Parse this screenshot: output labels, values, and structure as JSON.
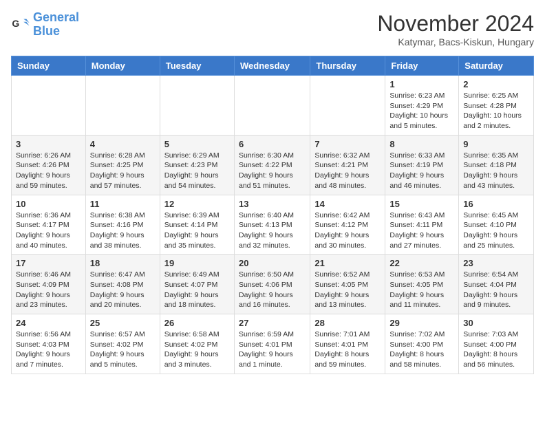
{
  "logo": {
    "line1": "General",
    "line2": "Blue"
  },
  "title": "November 2024",
  "location": "Katymar, Bacs-Kiskun, Hungary",
  "days_of_week": [
    "Sunday",
    "Monday",
    "Tuesday",
    "Wednesday",
    "Thursday",
    "Friday",
    "Saturday"
  ],
  "weeks": [
    [
      {
        "day": "",
        "info": ""
      },
      {
        "day": "",
        "info": ""
      },
      {
        "day": "",
        "info": ""
      },
      {
        "day": "",
        "info": ""
      },
      {
        "day": "",
        "info": ""
      },
      {
        "day": "1",
        "info": "Sunrise: 6:23 AM\nSunset: 4:29 PM\nDaylight: 10 hours and 5 minutes."
      },
      {
        "day": "2",
        "info": "Sunrise: 6:25 AM\nSunset: 4:28 PM\nDaylight: 10 hours and 2 minutes."
      }
    ],
    [
      {
        "day": "3",
        "info": "Sunrise: 6:26 AM\nSunset: 4:26 PM\nDaylight: 9 hours and 59 minutes."
      },
      {
        "day": "4",
        "info": "Sunrise: 6:28 AM\nSunset: 4:25 PM\nDaylight: 9 hours and 57 minutes."
      },
      {
        "day": "5",
        "info": "Sunrise: 6:29 AM\nSunset: 4:23 PM\nDaylight: 9 hours and 54 minutes."
      },
      {
        "day": "6",
        "info": "Sunrise: 6:30 AM\nSunset: 4:22 PM\nDaylight: 9 hours and 51 minutes."
      },
      {
        "day": "7",
        "info": "Sunrise: 6:32 AM\nSunset: 4:21 PM\nDaylight: 9 hours and 48 minutes."
      },
      {
        "day": "8",
        "info": "Sunrise: 6:33 AM\nSunset: 4:19 PM\nDaylight: 9 hours and 46 minutes."
      },
      {
        "day": "9",
        "info": "Sunrise: 6:35 AM\nSunset: 4:18 PM\nDaylight: 9 hours and 43 minutes."
      }
    ],
    [
      {
        "day": "10",
        "info": "Sunrise: 6:36 AM\nSunset: 4:17 PM\nDaylight: 9 hours and 40 minutes."
      },
      {
        "day": "11",
        "info": "Sunrise: 6:38 AM\nSunset: 4:16 PM\nDaylight: 9 hours and 38 minutes."
      },
      {
        "day": "12",
        "info": "Sunrise: 6:39 AM\nSunset: 4:14 PM\nDaylight: 9 hours and 35 minutes."
      },
      {
        "day": "13",
        "info": "Sunrise: 6:40 AM\nSunset: 4:13 PM\nDaylight: 9 hours and 32 minutes."
      },
      {
        "day": "14",
        "info": "Sunrise: 6:42 AM\nSunset: 4:12 PM\nDaylight: 9 hours and 30 minutes."
      },
      {
        "day": "15",
        "info": "Sunrise: 6:43 AM\nSunset: 4:11 PM\nDaylight: 9 hours and 27 minutes."
      },
      {
        "day": "16",
        "info": "Sunrise: 6:45 AM\nSunset: 4:10 PM\nDaylight: 9 hours and 25 minutes."
      }
    ],
    [
      {
        "day": "17",
        "info": "Sunrise: 6:46 AM\nSunset: 4:09 PM\nDaylight: 9 hours and 23 minutes."
      },
      {
        "day": "18",
        "info": "Sunrise: 6:47 AM\nSunset: 4:08 PM\nDaylight: 9 hours and 20 minutes."
      },
      {
        "day": "19",
        "info": "Sunrise: 6:49 AM\nSunset: 4:07 PM\nDaylight: 9 hours and 18 minutes."
      },
      {
        "day": "20",
        "info": "Sunrise: 6:50 AM\nSunset: 4:06 PM\nDaylight: 9 hours and 16 minutes."
      },
      {
        "day": "21",
        "info": "Sunrise: 6:52 AM\nSunset: 4:05 PM\nDaylight: 9 hours and 13 minutes."
      },
      {
        "day": "22",
        "info": "Sunrise: 6:53 AM\nSunset: 4:05 PM\nDaylight: 9 hours and 11 minutes."
      },
      {
        "day": "23",
        "info": "Sunrise: 6:54 AM\nSunset: 4:04 PM\nDaylight: 9 hours and 9 minutes."
      }
    ],
    [
      {
        "day": "24",
        "info": "Sunrise: 6:56 AM\nSunset: 4:03 PM\nDaylight: 9 hours and 7 minutes."
      },
      {
        "day": "25",
        "info": "Sunrise: 6:57 AM\nSunset: 4:02 PM\nDaylight: 9 hours and 5 minutes."
      },
      {
        "day": "26",
        "info": "Sunrise: 6:58 AM\nSunset: 4:02 PM\nDaylight: 9 hours and 3 minutes."
      },
      {
        "day": "27",
        "info": "Sunrise: 6:59 AM\nSunset: 4:01 PM\nDaylight: 9 hours and 1 minute."
      },
      {
        "day": "28",
        "info": "Sunrise: 7:01 AM\nSunset: 4:01 PM\nDaylight: 8 hours and 59 minutes."
      },
      {
        "day": "29",
        "info": "Sunrise: 7:02 AM\nSunset: 4:00 PM\nDaylight: 8 hours and 58 minutes."
      },
      {
        "day": "30",
        "info": "Sunrise: 7:03 AM\nSunset: 4:00 PM\nDaylight: 8 hours and 56 minutes."
      }
    ]
  ]
}
